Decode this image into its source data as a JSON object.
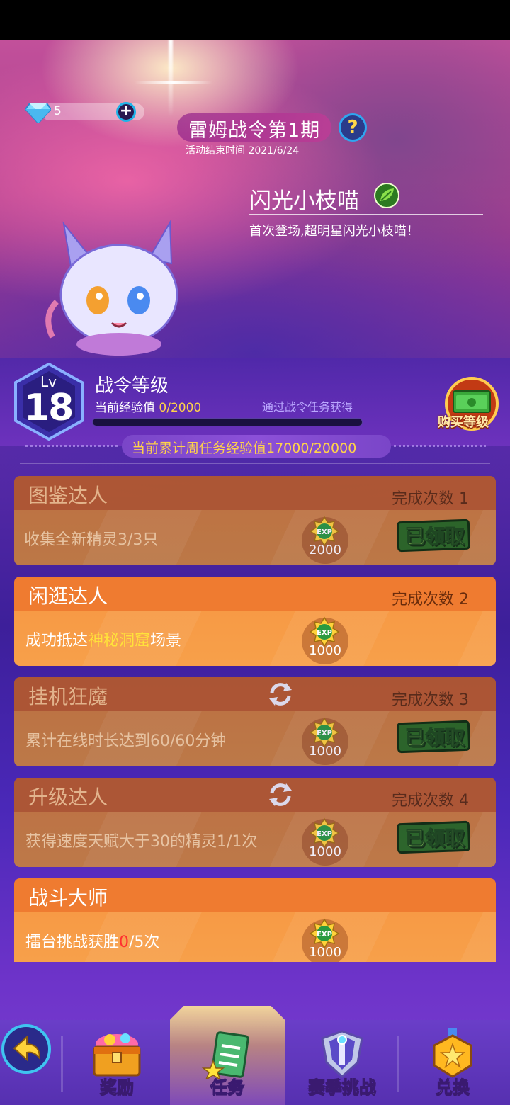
{
  "currency": {
    "icon": "diamond-icon",
    "value": "5"
  },
  "header": {
    "title": "雷姆战令第1期",
    "end_time": "活动结束时间 2021/6/24"
  },
  "pet": {
    "name": "闪光小枝喵",
    "desc": "首次登场,超明星闪光小枝喵！"
  },
  "level": {
    "lv_label": "Lv",
    "level": "18",
    "title": "战令等级",
    "exp_label": "当前经验值 ",
    "exp_value": "0/2000",
    "exp_progress": 0,
    "exp_source": "通过战令任务获得",
    "buy_label": "购买等级"
  },
  "weekly": "当前累计周任务经验值17000/20000",
  "tasks": [
    {
      "name": "图鉴达人",
      "count": "完成次数 1",
      "desc": "收集全新精灵3/3只",
      "exp": "2000",
      "status": "已领取"
    },
    {
      "name": "闲逛达人",
      "count": "完成次数 2",
      "desc_pre": "成功抵达",
      "desc_hl": "神秘洞窟",
      "desc_post": "场景",
      "exp": "1000"
    },
    {
      "name": "挂机狂魔",
      "count": "完成次数 3",
      "desc": "累计在线时长达到60/60分钟",
      "exp": "1000",
      "status": "已领取"
    },
    {
      "name": "升级达人",
      "count": "完成次数 4",
      "desc": "获得速度天赋大于30的精灵1/1次",
      "exp": "1000",
      "status": "已领取"
    },
    {
      "name": "战斗大师",
      "desc_pre": "擂台挑战获胜",
      "desc_red": "0",
      "desc_post": "/5次",
      "exp": "1000"
    }
  ],
  "nav": {
    "rewards": "奖励",
    "tasks": "任务",
    "season": "赛季挑战",
    "exchange": "兑换"
  }
}
